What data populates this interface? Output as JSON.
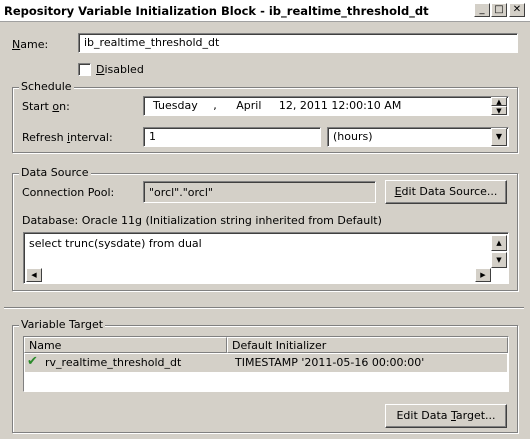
{
  "window": {
    "title": "Repository Variable Initialization Block - ib_realtime_threshold_dt",
    "minimize": "_",
    "maximize": "□",
    "close": "✕"
  },
  "name": {
    "label_pre": "",
    "label_u": "N",
    "label_post": "ame:",
    "value": "ib_realtime_threshold_dt"
  },
  "disabled": {
    "label_u": "D",
    "label_post": "isabled",
    "checked": false
  },
  "schedule": {
    "title": "Schedule",
    "start_label_pre": "Start ",
    "start_label_u": "o",
    "start_label_post": "n:",
    "start_weekday": "Tuesday",
    "start_sep": ",",
    "start_month": "April",
    "start_rest": "12, 2011 12:00:10 AM",
    "refresh_label_pre": "Refresh ",
    "refresh_label_u": "i",
    "refresh_label_post": "nterval:",
    "refresh_value": "1",
    "refresh_unit": "(hours)"
  },
  "data_source": {
    "title": "Data Source",
    "pool_label": "Connection Pool:",
    "pool_value": "\"orcl\".\"orcl\"",
    "edit_btn_u": "E",
    "edit_btn_post": "dit Data Source...",
    "database_info": "Database: Oracle 11g (Initialization string inherited from Default)",
    "sql": "select trunc(sysdate) from dual"
  },
  "variable_target": {
    "title": "Variable Target",
    "columns": [
      "Name",
      "Default Initializer"
    ],
    "rows": [
      {
        "name": "rv_realtime_threshold_dt",
        "initializer": "TIMESTAMP '2011-05-16 00:00:00'"
      }
    ],
    "edit_btn_pre": "Edit Data ",
    "edit_btn_u": "T",
    "edit_btn_post": "arget..."
  },
  "icons": {
    "row_icon": "variable-check-icon",
    "dropdown": "chevron-down-icon",
    "spin_up": "arrow-up-icon",
    "spin_down": "arrow-down-icon"
  }
}
